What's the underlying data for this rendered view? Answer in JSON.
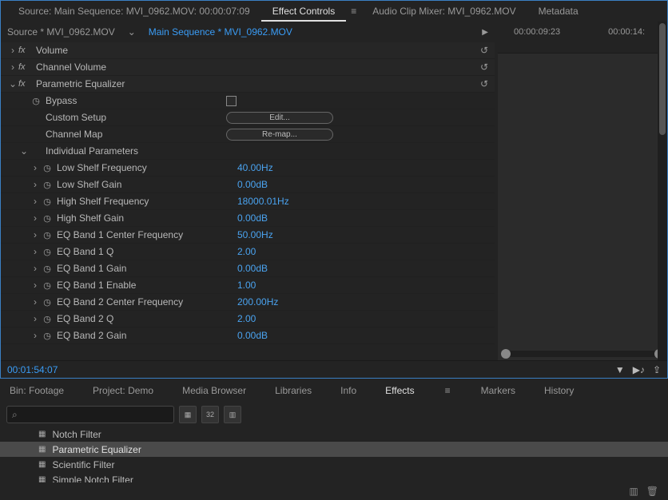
{
  "top_tabs": {
    "source": "Source: Main Sequence: MVI_0962.MOV: 00:00:07:09",
    "effect_controls": "Effect Controls",
    "audio_mixer": "Audio Clip Mixer: MVI_0962.MOV",
    "metadata": "Metadata"
  },
  "source_row": {
    "source": "Source * MVI_0962.MOV",
    "sequence": "Main Sequence * MVI_0962.MOV"
  },
  "timeline": {
    "t1": "00:00:09:23",
    "t2": "00:00:14:"
  },
  "effects": {
    "volume": {
      "label": "Volume"
    },
    "channel_volume": {
      "label": "Channel Volume"
    },
    "parametric": {
      "label": "Parametric Equalizer",
      "bypass": "Bypass",
      "custom_setup": "Custom Setup",
      "edit_btn": "Edit...",
      "channel_map": "Channel Map",
      "remap_btn": "Re-map...",
      "individual": "Individual Parameters",
      "params": [
        {
          "label": "Low Shelf Frequency",
          "value": "40.00Hz"
        },
        {
          "label": "Low Shelf Gain",
          "value": "0.00dB"
        },
        {
          "label": "High Shelf Frequency",
          "value": "18000.01Hz"
        },
        {
          "label": "High Shelf Gain",
          "value": "0.00dB"
        },
        {
          "label": "EQ Band 1 Center Frequency",
          "value": "50.00Hz"
        },
        {
          "label": "EQ Band 1 Q",
          "value": "2.00"
        },
        {
          "label": "EQ Band 1 Gain",
          "value": "0.00dB"
        },
        {
          "label": "EQ Band 1 Enable",
          "value": "1.00"
        },
        {
          "label": "EQ Band 2 Center Frequency",
          "value": "200.00Hz"
        },
        {
          "label": "EQ Band 2 Q",
          "value": "2.00"
        },
        {
          "label": "EQ Band 2 Gain",
          "value": "0.00dB"
        }
      ]
    }
  },
  "status": {
    "timecode": "00:01:54:07"
  },
  "bottom_tabs": {
    "bin": "Bin: Footage",
    "project": "Project: Demo",
    "media_browser": "Media Browser",
    "libraries": "Libraries",
    "info": "Info",
    "effects": "Effects",
    "markers": "Markers",
    "history": "History"
  },
  "effects_panel": {
    "items": [
      {
        "label": "Notch Filter"
      },
      {
        "label": "Parametric Equalizer"
      },
      {
        "label": "Scientific Filter"
      },
      {
        "label": "Simple Notch Filter"
      }
    ]
  },
  "toolbar_icons": {
    "b1": "▦",
    "b2": "32",
    "b3": "▥"
  }
}
